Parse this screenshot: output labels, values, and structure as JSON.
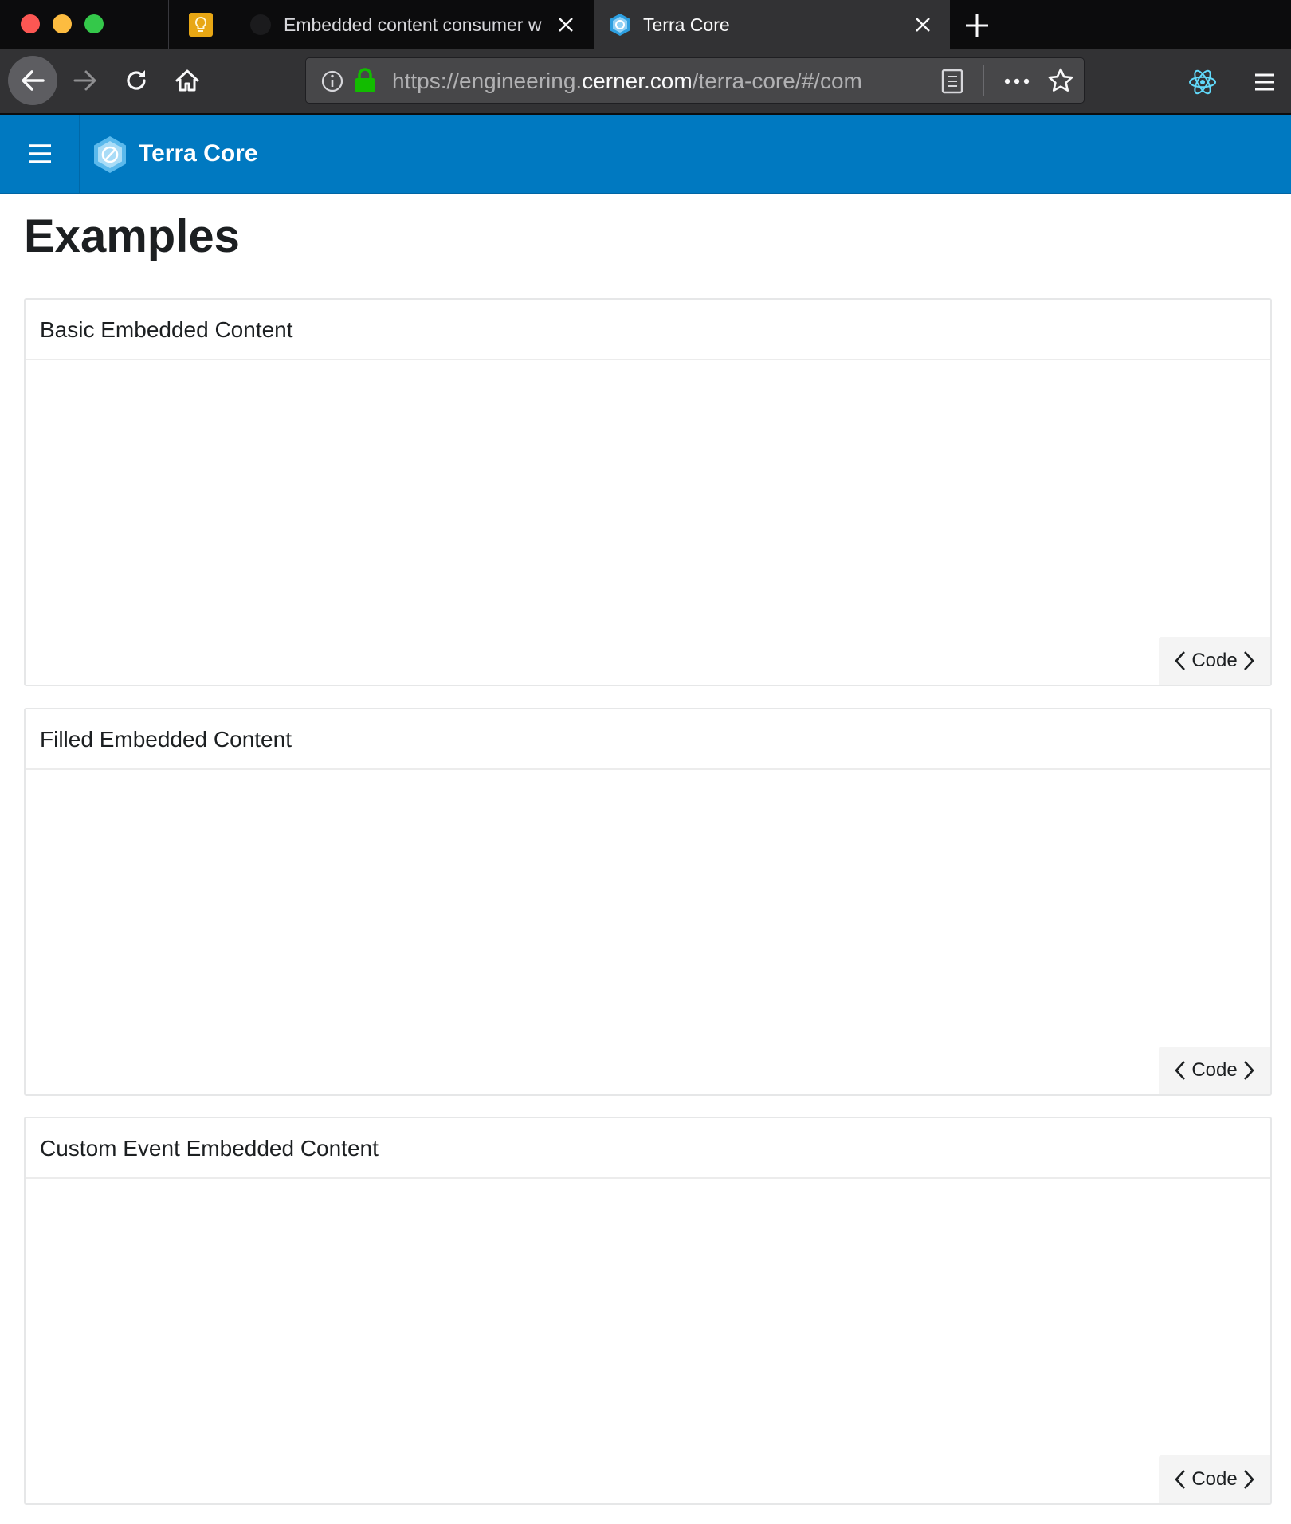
{
  "browser": {
    "tabs": [
      {
        "title": "",
        "pinned": true,
        "icon": "lightbulb-icon"
      },
      {
        "title": "Embedded content consumer w",
        "icon": "github-icon"
      },
      {
        "title": "Terra Core",
        "icon": "terra-hex-icon",
        "active": true
      }
    ],
    "url": {
      "prefix": "https://engineering.",
      "host": "cerner.com",
      "path": "/terra-core/#/com"
    },
    "colors": {
      "tabstrip": "#0c0c0d",
      "toolbar": "#323234",
      "lock": "#12bc00"
    }
  },
  "app": {
    "title": "Terra Core",
    "header_color": "#0079c1"
  },
  "page": {
    "title": "Examples",
    "examples": [
      {
        "title": "Basic Embedded Content",
        "code_label": "Code"
      },
      {
        "title": "Filled Embedded Content",
        "code_label": "Code"
      },
      {
        "title": "Custom Event Embedded Content",
        "code_label": "Code"
      }
    ]
  }
}
